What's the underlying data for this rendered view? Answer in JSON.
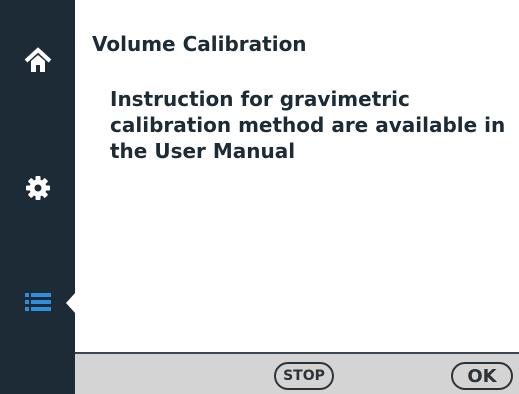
{
  "sidebar": {
    "items": [
      {
        "icon": "home-icon",
        "color": "#ffffff",
        "active": false
      },
      {
        "icon": "gear-icon",
        "color": "#ffffff",
        "active": false
      },
      {
        "icon": "list-icon",
        "color": "#2f8fdc",
        "active": true
      }
    ]
  },
  "screen": {
    "title": "Volume Calibration",
    "message": "Instruction for gravimetric calibration method are available in the User Manual"
  },
  "footer": {
    "stop_label": "STOP",
    "ok_label": "OK"
  },
  "colors": {
    "sidebar_bg": "#1d2b36",
    "accent": "#2f8fdc",
    "footer_bg": "#d4d4d4",
    "text": "#1d2b36"
  }
}
